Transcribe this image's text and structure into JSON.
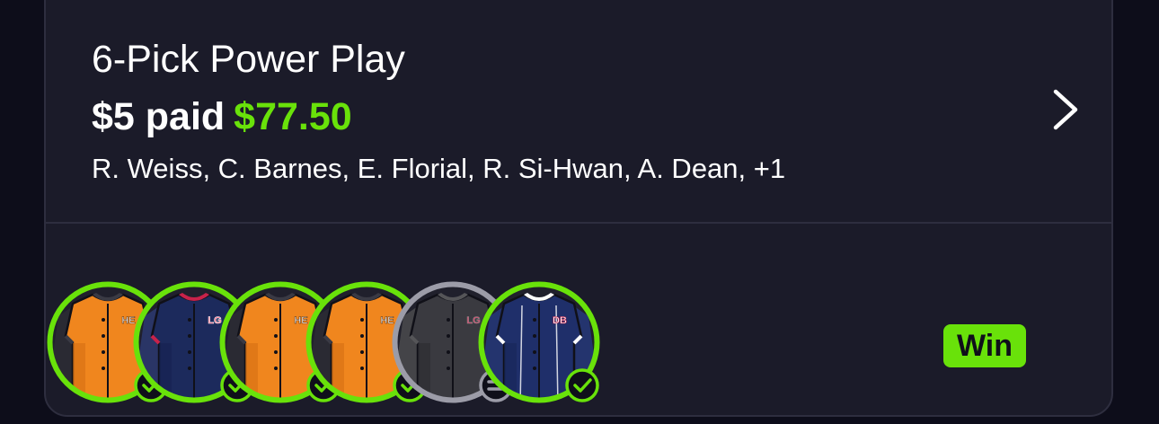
{
  "entry": {
    "title": "6-Pick Power Play",
    "paid_label": "$5 paid",
    "payout": "$77.50",
    "players": "R. Weiss, C. Barnes, E. Florial, R. Si-Hwan, A. Dean, +1",
    "result": "Win"
  },
  "picks": [
    {
      "team": "HE",
      "jersey": "orange",
      "status": "win"
    },
    {
      "team": "LG",
      "jersey": "navy",
      "status": "win"
    },
    {
      "team": "HE",
      "jersey": "orange",
      "status": "win"
    },
    {
      "team": "HE",
      "jersey": "orange",
      "status": "win"
    },
    {
      "team": "LG",
      "jersey": "gray",
      "status": "push"
    },
    {
      "team": "DB",
      "jersey": "navy-pinstripe",
      "status": "win"
    }
  ],
  "colors": {
    "background": "#0d0d1a",
    "card": "#1b1b29",
    "accent_green": "#69e20a",
    "push_gray": "#9c9ca8",
    "orange_jersey": "#f0861e",
    "navy_jersey": "#1c2a5c",
    "gray_jersey": "#3a3a40"
  },
  "icons": {
    "chevron": "chevron-right-icon",
    "win_status": "check-circle-icon",
    "push_status": "equals-circle-icon"
  }
}
